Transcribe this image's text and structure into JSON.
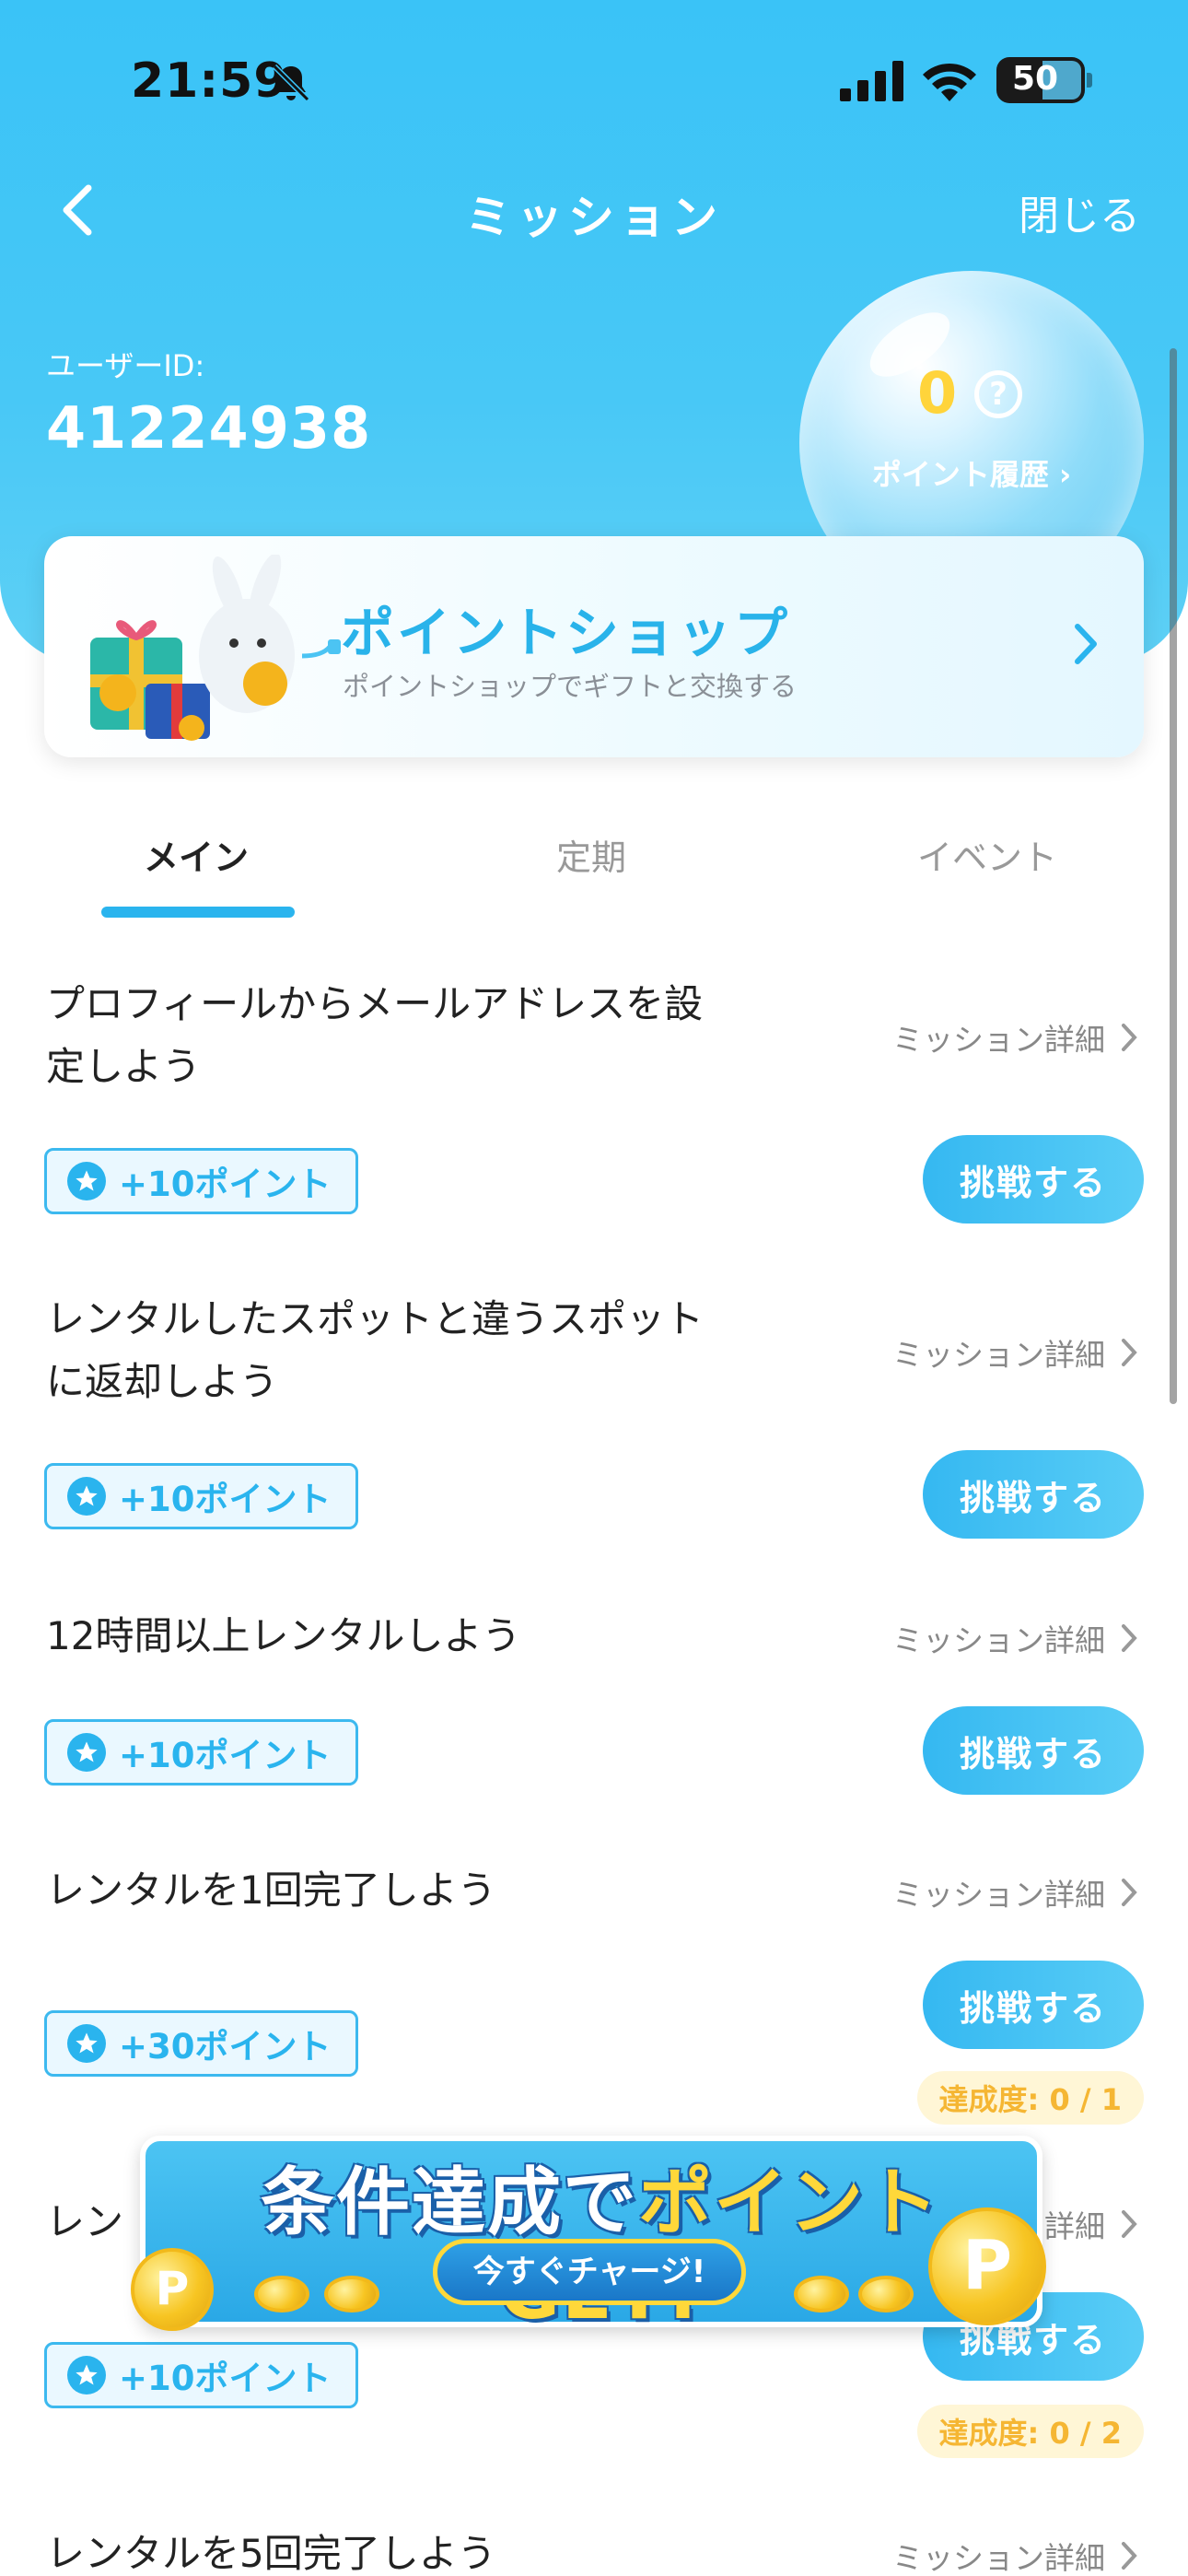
{
  "status_bar": {
    "time": "21:59",
    "battery": "50"
  },
  "nav": {
    "title": "ミッション",
    "close": "閉じる"
  },
  "user": {
    "id_label": "ユーザーID:",
    "id_value": "41224938"
  },
  "points": {
    "value": "0",
    "history_label": "ポイント履歴 ›"
  },
  "shop": {
    "title": "ポイントショップ",
    "subtitle": "ポイントショップでギフトと交換する"
  },
  "tabs": [
    {
      "label": "メイン",
      "active": true
    },
    {
      "label": "定期",
      "active": false
    },
    {
      "label": "イベント",
      "active": false
    }
  ],
  "missions": [
    {
      "title": "プロフィールからメールアドレスを設定しよう",
      "detail": "ミッション詳細",
      "reward": "+10ポイント",
      "button": "挑戦する"
    },
    {
      "title": "レンタルしたスポットと違うスポットに返却しよう",
      "detail": "ミッション詳細",
      "reward": "+10ポイント",
      "button": "挑戦する"
    },
    {
      "title": "12時間以上レンタルしよう",
      "detail": "ミッション詳細",
      "reward": "+10ポイント",
      "button": "挑戦する"
    },
    {
      "title": "レンタルを1回完了しよう",
      "detail": "ミッション詳細",
      "reward": "+30ポイント",
      "button": "挑戦する",
      "progress": "達成度: 0 / 1"
    },
    {
      "title": "レン",
      "detail": "ミッション詳細",
      "reward": "+10ポイント",
      "button": "挑戦する",
      "progress": "達成度: 0 / 2"
    },
    {
      "title": "レンタルを5回完了しよう",
      "detail": "ミッション詳細"
    }
  ],
  "ad": {
    "title_prefix": "条件達成で",
    "title_highlight": "ポイントGET!",
    "cta": "今すぐチャージ!",
    "coin_letter": "P"
  },
  "colors": {
    "primary": "#2ab4ee",
    "header": "#3ac3f7",
    "points": "#ffd43b",
    "progress_text": "#f5b633",
    "progress_bg": "#fff6d6"
  }
}
